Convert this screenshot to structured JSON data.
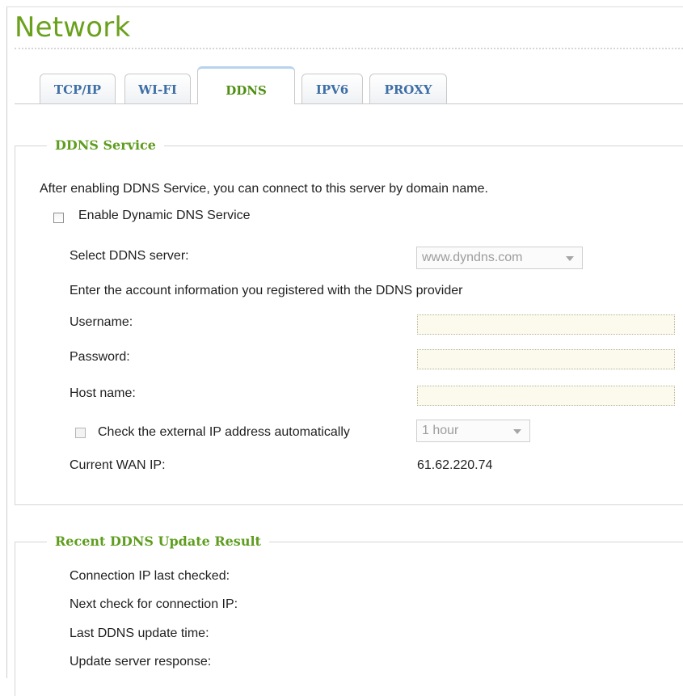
{
  "page": {
    "title": "Network"
  },
  "tabs": [
    {
      "label": "TCP/IP",
      "active": false
    },
    {
      "label": "WI-FI",
      "active": false
    },
    {
      "label": "DDNS",
      "active": true
    },
    {
      "label": "IPV6",
      "active": false
    },
    {
      "label": "PROXY",
      "active": false
    }
  ],
  "ddns_service": {
    "legend": "DDNS Service",
    "intro": "After enabling DDNS Service, you can connect to this server by domain name.",
    "enable_label": "Enable Dynamic DNS Service",
    "enable_checked": false,
    "server_label": "Select DDNS server:",
    "server_value": "www.dyndns.com",
    "account_info": "Enter the account information you registered with the DDNS provider",
    "username_label": "Username:",
    "username_value": "",
    "password_label": "Password:",
    "password_value": "",
    "hostname_label": "Host name:",
    "hostname_value": "",
    "check_ip_label": "Check the external IP address automatically",
    "check_ip_checked": false,
    "interval_value": "1 hour",
    "wan_ip_label": "Current WAN IP:",
    "wan_ip_value": "61.62.220.74"
  },
  "recent_result": {
    "legend": "Recent DDNS Update Result",
    "rows": [
      {
        "label": "Connection IP last checked:"
      },
      {
        "label": "Next check for connection IP:"
      },
      {
        "label": "Last DDNS update time:"
      },
      {
        "label": "Update server response:"
      }
    ]
  },
  "colors": {
    "title_green": "#6aa11c",
    "legend_green": "#5e9d1e",
    "tab_blue": "#3d6fa6",
    "input_bg": "#fbfaec"
  }
}
